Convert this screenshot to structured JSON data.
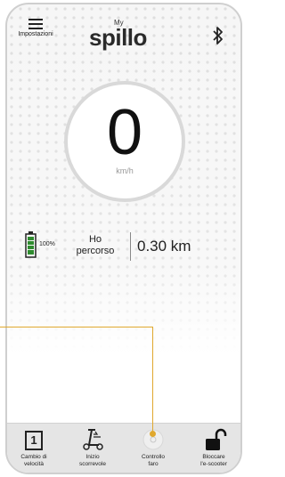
{
  "header": {
    "menu_label": "Impostazioni",
    "logo_small": "My",
    "logo_main": "spillo",
    "bluetooth_icon": "bluetooth-icon"
  },
  "speed": {
    "value": "0",
    "unit": "km/h"
  },
  "trip": {
    "battery_percent": "100%",
    "label_line1": "Ho",
    "label_line2": "percorso",
    "distance": "0.30 km"
  },
  "bottom_bar": {
    "items": [
      {
        "line1": "Cambio di",
        "line2": "velocità",
        "icon": "speed-mode-icon",
        "value": "1"
      },
      {
        "line1": "Inizio",
        "line2": "scorrevole",
        "icon": "scooter-start-icon"
      },
      {
        "line1": "Controllo",
        "line2": "faro",
        "icon": "headlight-icon"
      },
      {
        "line1": "Bloccare",
        "line2": "l'e-scooter",
        "icon": "unlock-icon"
      }
    ]
  },
  "colors": {
    "accent": "#e0a82e",
    "battery": "#2e8b2e",
    "bar_bg": "#e5e5e5"
  }
}
